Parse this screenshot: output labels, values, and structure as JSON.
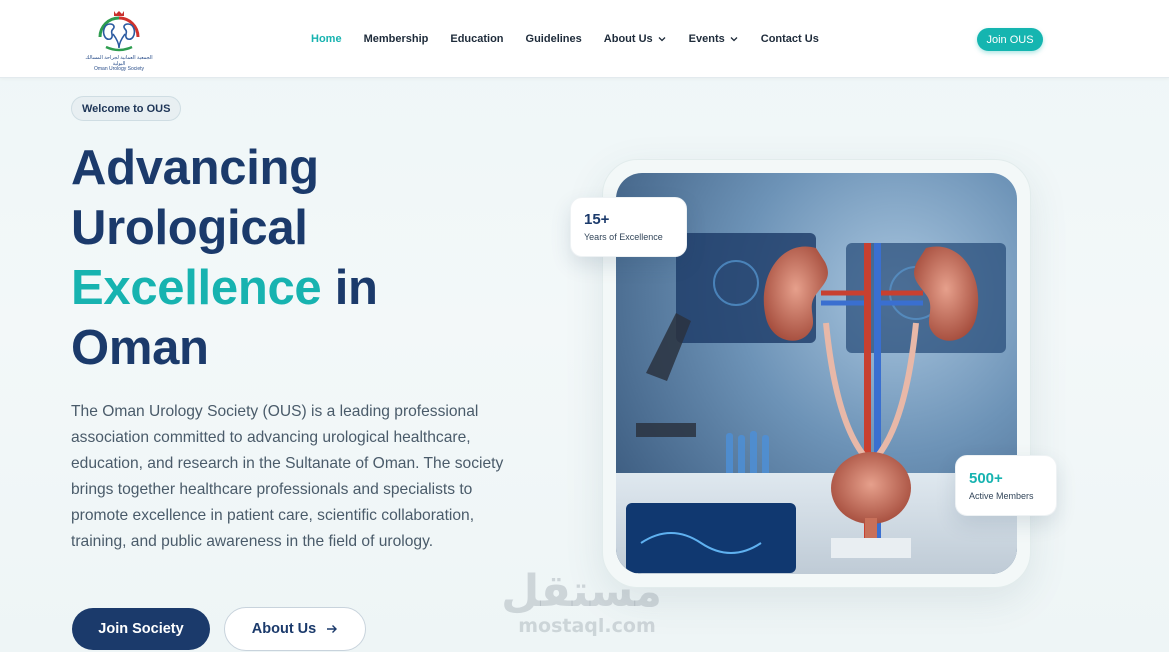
{
  "header": {
    "logo_caption_ar": "الجمعية العمانية لجراحة المسالك البولية",
    "logo_caption_en": "Oman Urology Society",
    "nav": [
      {
        "label": "Home",
        "active": true,
        "dropdown": false
      },
      {
        "label": "Membership",
        "active": false,
        "dropdown": false
      },
      {
        "label": "Education",
        "active": false,
        "dropdown": false
      },
      {
        "label": "Guidelines",
        "active": false,
        "dropdown": false
      },
      {
        "label": "About Us",
        "active": false,
        "dropdown": true
      },
      {
        "label": "Events",
        "active": false,
        "dropdown": true
      },
      {
        "label": "Contact Us",
        "active": false,
        "dropdown": false
      }
    ],
    "join_label": "Join OUS"
  },
  "hero": {
    "badge": "Welcome to OUS",
    "headline_1": "Advancing",
    "headline_2": "Urological",
    "headline_accent": "Excellence",
    "headline_3": "in",
    "headline_4": "Oman",
    "description": "The Oman Urology Society (OUS) is a leading professional association committed to advancing urological healthcare, education, and research in the Sultanate of Oman. The society brings together healthcare professionals and specialists to promote excellence in patient care, scientific collaboration, training, and public awareness in the field of urology.",
    "primary_button": "Join Society",
    "secondary_button": "About Us",
    "stats": [
      {
        "value": "15+",
        "label": "Years of Excellence"
      },
      {
        "value": "500+",
        "label": "Active Members"
      }
    ]
  },
  "watermark": {
    "arabic": "مستقل",
    "latin": "mostaql.com"
  },
  "colors": {
    "brand_navy": "#1b3a6b",
    "brand_teal": "#17b3b0"
  },
  "icons": [
    "logo-emblem",
    "chevron-down-icon",
    "arrow-right-icon"
  ]
}
